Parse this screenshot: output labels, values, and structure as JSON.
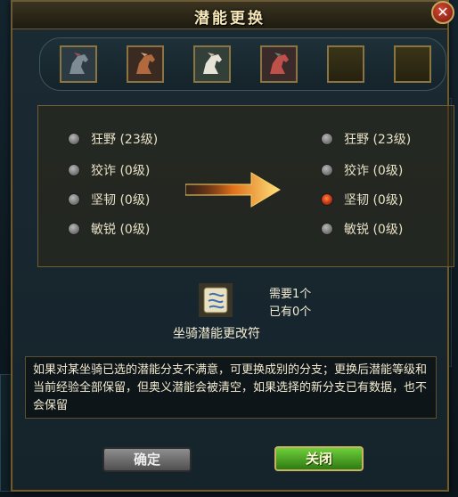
{
  "dialog": {
    "title": "潜能更换",
    "close_glyph": "✕"
  },
  "horse_slots": [
    {
      "icon": "horse-icon-dark"
    },
    {
      "icon": "horse-icon-brown"
    },
    {
      "icon": "horse-icon-white"
    },
    {
      "icon": "horse-icon-red"
    },
    {
      "icon": "empty-slot"
    },
    {
      "icon": "empty-slot"
    }
  ],
  "current_options": [
    {
      "label": "狂野 (23级)",
      "selected": false
    },
    {
      "label": "狡诈 (0级)",
      "selected": false
    },
    {
      "label": "坚韧 (0级)",
      "selected": false
    },
    {
      "label": "敏锐 (0级)",
      "selected": false
    }
  ],
  "new_options": [
    {
      "label": "狂野 (23级)",
      "selected": false
    },
    {
      "label": "狡诈 (0级)",
      "selected": false
    },
    {
      "label": "坚韧 (0级)",
      "selected": true
    },
    {
      "label": "敏锐 (0级)",
      "selected": false
    }
  ],
  "item": {
    "name": "坐骑潜能更改符",
    "need": "需要1个",
    "have": "已有0个"
  },
  "description": "如果对某坐骑已选的潜能分支不满意，可更换成别的分支；更换后潜能等级和当前经验全部保留，但奥义潜能会被清空，如果选择的新分支已有数据，也不会保留",
  "buttons": {
    "confirm": "确定",
    "close": "关闭"
  },
  "colors": {
    "accent_gold": "#c9a55a",
    "selected_radio": "#d0401b",
    "close_button_green": "#2e7a12"
  }
}
